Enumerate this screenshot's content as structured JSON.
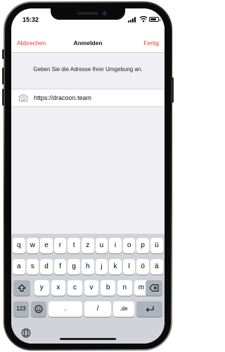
{
  "status_bar": {
    "time": "15:32",
    "battery_level": 0.8
  },
  "nav": {
    "cancel_label": "Abbrechen",
    "title": "Anmelden",
    "done_label": "Fertig",
    "accent_color": "#d9432f"
  },
  "instruction": "Geben Sie die Adresse Ihrer Umgebung an.",
  "url_field": {
    "value": "https://dracoon.team",
    "icon": "camera-icon"
  },
  "keyboard": {
    "row1": [
      "q",
      "w",
      "e",
      "r",
      "t",
      "z",
      "u",
      "i",
      "o",
      "p",
      "ü"
    ],
    "row2": [
      "a",
      "s",
      "d",
      "f",
      "g",
      "h",
      "j",
      "k",
      "l",
      "ö",
      "ä"
    ],
    "row3": [
      "y",
      "x",
      "c",
      "v",
      "b",
      "n",
      "m"
    ],
    "bottom": {
      "numbers_label": "123",
      "dot_label": ".",
      "slash_label": "/",
      "domain_label": ".de"
    },
    "icons": [
      "shift-icon",
      "backspace-icon",
      "emoji-icon",
      "return-icon",
      "globe-icon"
    ]
  }
}
